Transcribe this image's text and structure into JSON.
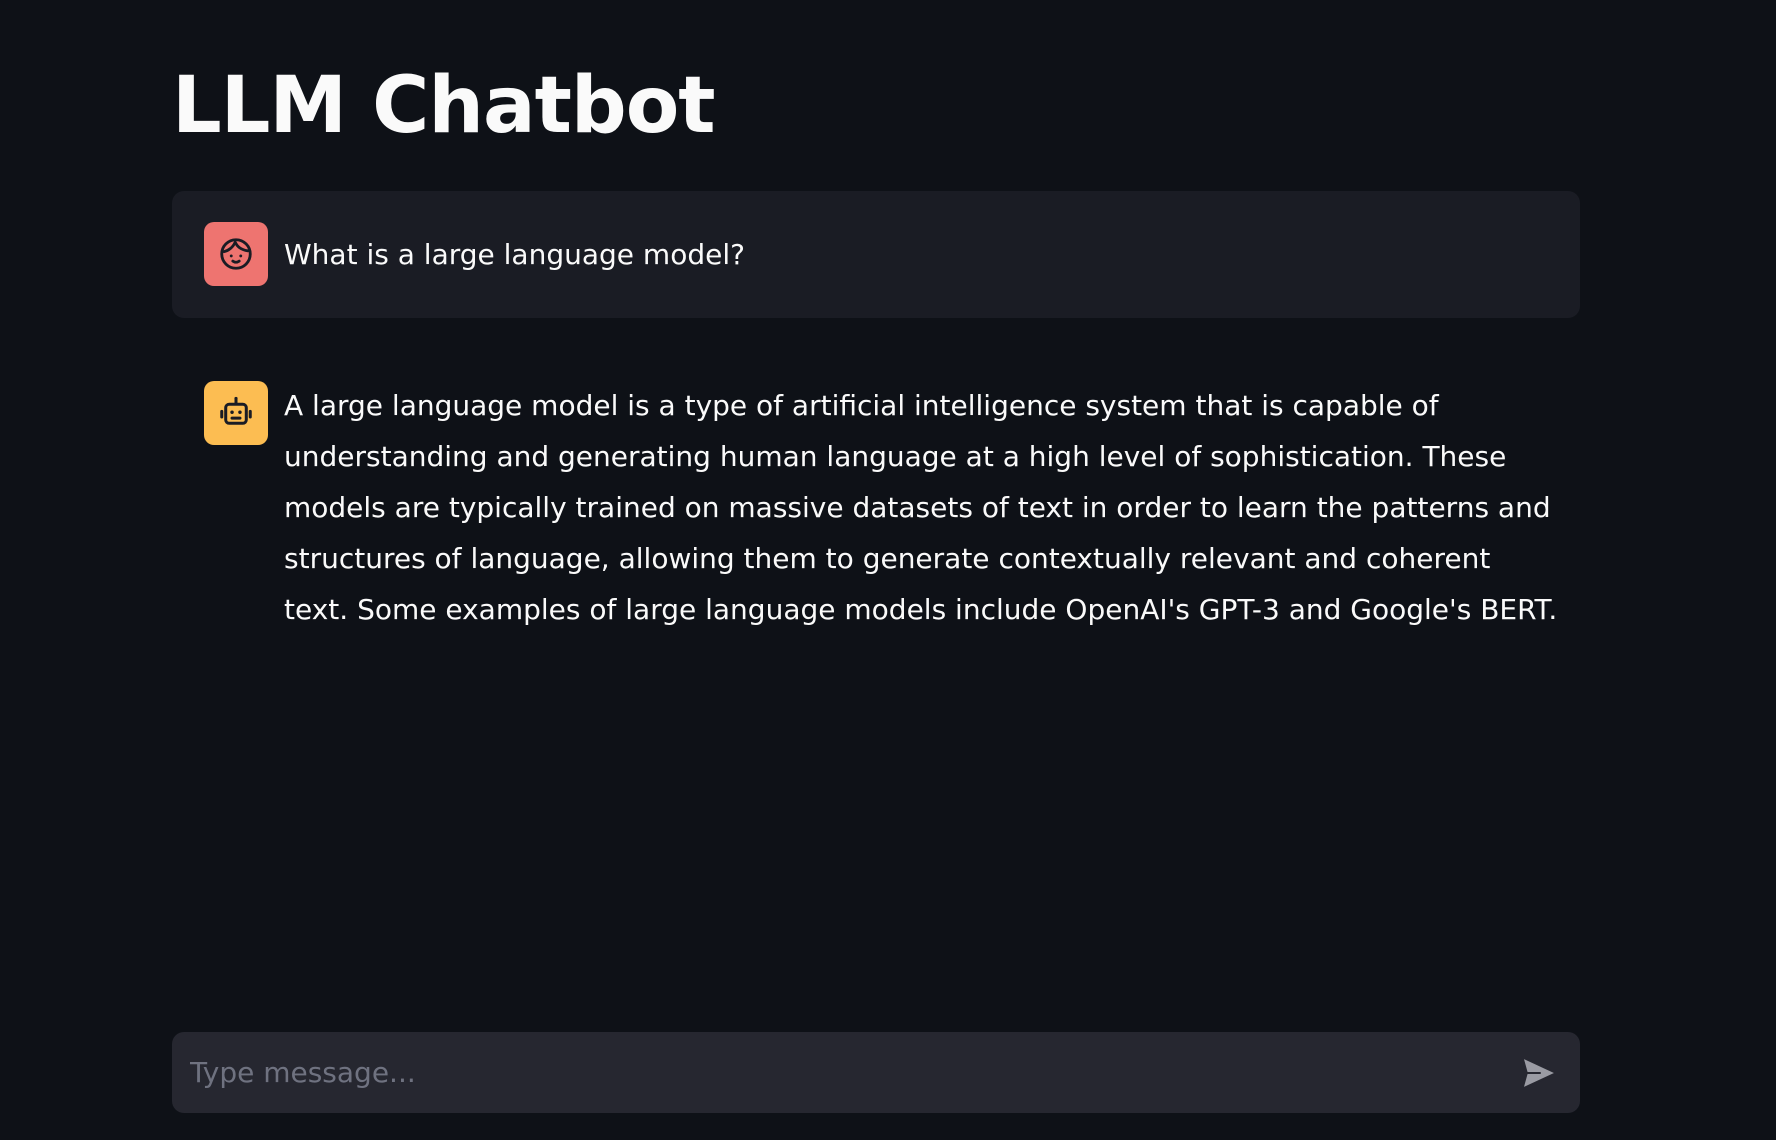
{
  "app": {
    "title": "LLM Chatbot"
  },
  "messages": [
    {
      "role": "user",
      "avatar_icon": "user-face-icon",
      "avatar_color": "#ee7470",
      "text": "What is a large language model?"
    },
    {
      "role": "assistant",
      "avatar_icon": "robot-icon",
      "avatar_color": "#fcbd52",
      "text": "A large language model is a type of artificial intelligence system that is capable of understanding and generating human language at a high level of sophistication. These models are typically trained on massive datasets of text in order to learn the patterns and structures of language, allowing them to generate contextually relevant and coherent text. Some examples of large language models include OpenAI's GPT-3 and Google's BERT."
    }
  ],
  "chat_input": {
    "placeholder": "Type message...",
    "value": "",
    "send_icon": "send-icon"
  },
  "colors": {
    "background": "#0e1117",
    "user_message_bg": "#1a1c24",
    "input_bg": "#262730",
    "text": "#fafafa"
  }
}
